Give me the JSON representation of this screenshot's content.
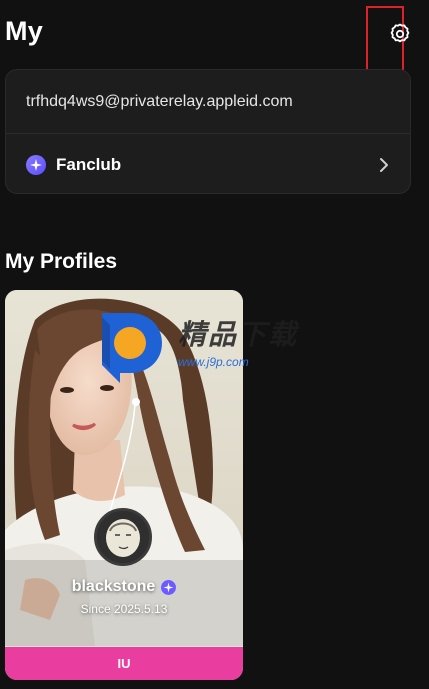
{
  "header": {
    "title": "My",
    "settings_icon": "gear-icon"
  },
  "account": {
    "email": "trfhdq4ws9@privaterelay.appleid.com",
    "fanclub_label": "Fanclub",
    "fanclub_icon": "sparkle-icon",
    "chevron_icon": "chevron-right-icon"
  },
  "profiles_section": {
    "title": "My Profiles",
    "profiles": [
      {
        "name": "blackstone",
        "since": "Since 2025.5.13",
        "artist": "IU",
        "artist_color": "#e93e9f"
      }
    ]
  },
  "watermark": {
    "text": "精品下载",
    "url": "www.j9p.com"
  },
  "colors": {
    "background": "#111111",
    "card": "#1d1d1d",
    "accent": "#6a5cff",
    "highlight_box": "#e0202a"
  }
}
